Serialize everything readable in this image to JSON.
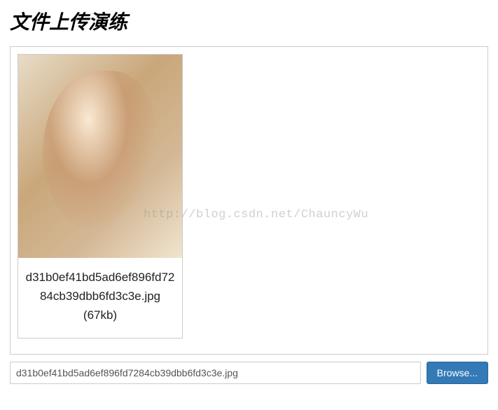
{
  "page": {
    "title": "文件上传演练"
  },
  "preview": {
    "file_name": "d31b0ef41bd5ad6ef896fd7284cb39dbb6fd3c3e.jpg",
    "file_size_label": "(67kb)"
  },
  "watermark": {
    "text": "http://blog.csdn.net/ChauncyWu"
  },
  "file_input": {
    "selected_file": "d31b0ef41bd5ad6ef896fd7284cb39dbb6fd3c3e.jpg",
    "browse_label": "Browse..."
  }
}
